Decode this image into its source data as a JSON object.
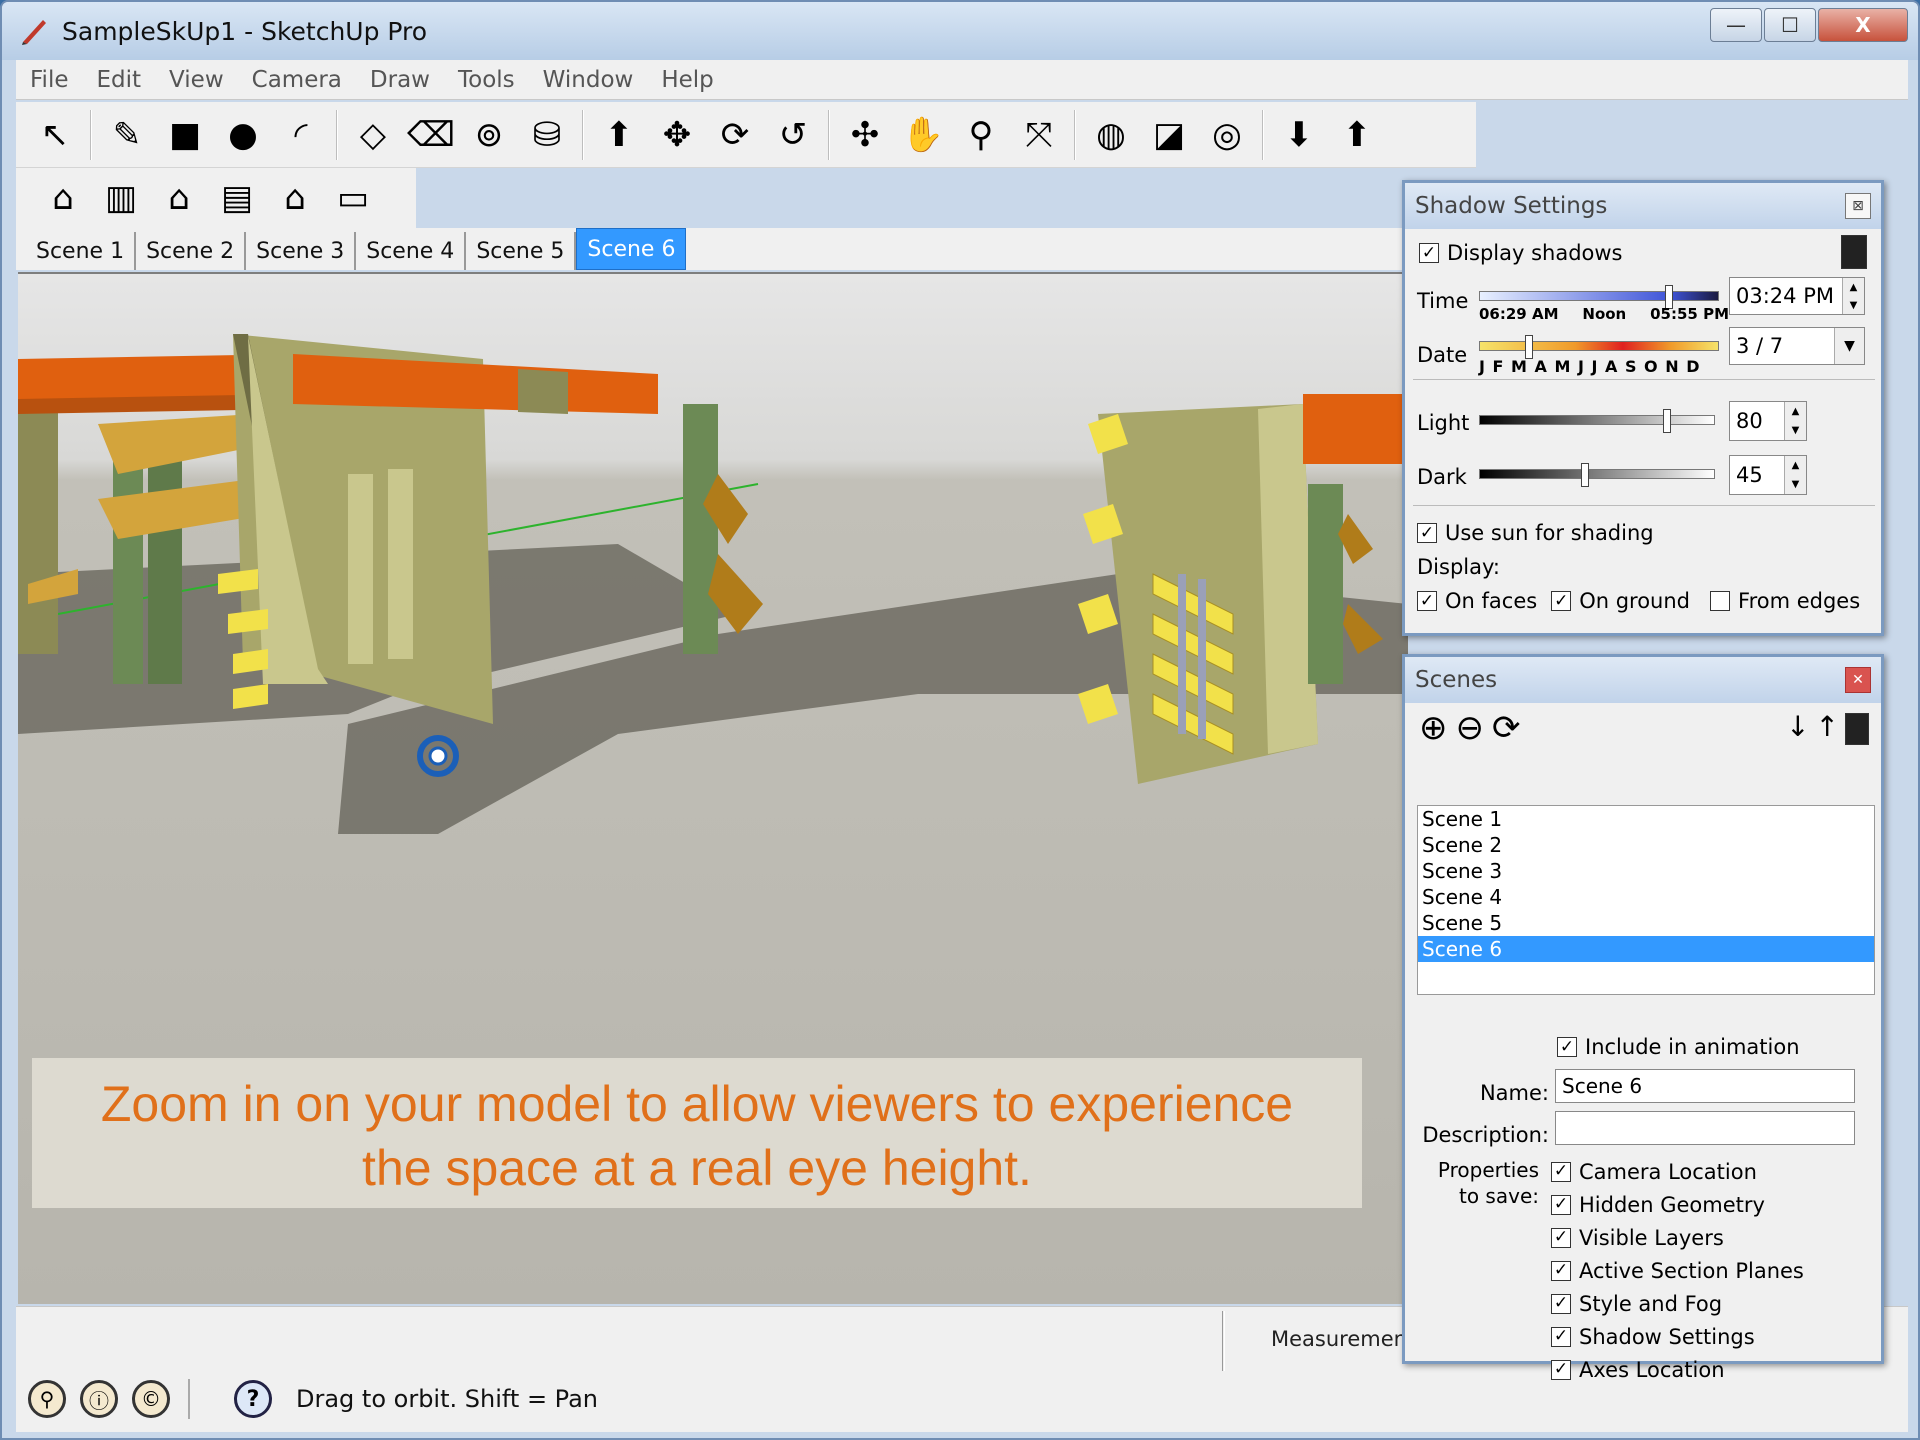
{
  "window": {
    "title": "SampleSkUp1 - SketchUp Pro",
    "minimize": "—",
    "maximize": "☐",
    "close": "X"
  },
  "menu": [
    "File",
    "Edit",
    "View",
    "Camera",
    "Draw",
    "Tools",
    "Window",
    "Help"
  ],
  "toolbar1": [
    {
      "name": "select-tool-icon",
      "glyph": "↖"
    },
    {
      "name": "pencil-tool-icon",
      "glyph": "✎"
    },
    {
      "name": "rectangle-tool-icon",
      "glyph": "■"
    },
    {
      "name": "circle-tool-icon",
      "glyph": "●"
    },
    {
      "name": "arc-tool-icon",
      "glyph": "◜"
    },
    {
      "name": "make-component-icon",
      "glyph": "◇"
    },
    {
      "name": "eraser-tool-icon",
      "glyph": "⌫"
    },
    {
      "name": "tape-measure-icon",
      "glyph": "⊚"
    },
    {
      "name": "paint-bucket-icon",
      "glyph": "⛁"
    },
    {
      "name": "push-pull-icon",
      "glyph": "⬆"
    },
    {
      "name": "move-tool-icon",
      "glyph": "✥"
    },
    {
      "name": "rotate-tool-icon",
      "glyph": "⟳"
    },
    {
      "name": "offset-tool-icon",
      "glyph": "↺"
    },
    {
      "name": "orbit-tool-icon",
      "glyph": "✣"
    },
    {
      "name": "pan-tool-icon",
      "glyph": "✋"
    },
    {
      "name": "zoom-tool-icon",
      "glyph": "⚲"
    },
    {
      "name": "zoom-extents-icon",
      "glyph": "⤧"
    },
    {
      "name": "get-models-icon",
      "glyph": "◍"
    },
    {
      "name": "share-model-icon",
      "glyph": "◪"
    },
    {
      "name": "earth-icon",
      "glyph": "◎"
    },
    {
      "name": "get-components-icon",
      "glyph": "⬇"
    },
    {
      "name": "share-component-icon",
      "glyph": "⬆"
    }
  ],
  "toolbar2": [
    {
      "name": "iso-view-icon",
      "glyph": "⌂"
    },
    {
      "name": "top-view-icon",
      "glyph": "▥"
    },
    {
      "name": "front-view-icon",
      "glyph": "⌂"
    },
    {
      "name": "right-view-icon",
      "glyph": "▤"
    },
    {
      "name": "back-view-icon",
      "glyph": "⌂"
    },
    {
      "name": "left-view-icon",
      "glyph": "▭"
    }
  ],
  "scene_tabs": [
    "Scene 1",
    "Scene 2",
    "Scene 3",
    "Scene 4",
    "Scene 5",
    "Scene 6"
  ],
  "active_scene_tab": "Scene 6",
  "caption": {
    "line1": "Zoom in on your model to allow viewers to experience",
    "line2": "the space at a real eye height."
  },
  "status": {
    "measurements_label": "Measurements",
    "message": "Drag to orbit.  Shift = Pan",
    "icons": [
      "geo-location-icon",
      "credits-icon",
      "license-icon"
    ]
  },
  "shadow_settings": {
    "title": "Shadow Settings",
    "display_shadows": "Display shadows",
    "time_label": "Time",
    "time_ticks": [
      "06:29 AM",
      "Noon",
      "05:55 PM"
    ],
    "time_value": "03:24 PM",
    "time_fraction": 0.82,
    "date_label": "Date",
    "months": "J F M A M J J A S O N D",
    "date_value": "3 / 7",
    "date_fraction": 0.2,
    "light_label": "Light",
    "light_value": "80",
    "dark_label": "Dark",
    "dark_value": "45",
    "use_sun": "Use sun for shading",
    "display_label": "Display:",
    "on_faces": "On faces",
    "on_ground": "On ground",
    "from_edges": "From edges"
  },
  "scenes_panel": {
    "title": "Scenes",
    "list": [
      "Scene 1",
      "Scene 2",
      "Scene 3",
      "Scene 4",
      "Scene 5",
      "Scene 6"
    ],
    "selected": "Scene 6",
    "include_animation": "Include in animation",
    "name_label": "Name:",
    "name_value": "Scene 6",
    "description_label": "Description:",
    "description_value": "",
    "properties_label_1": "Properties",
    "properties_label_2": "to save:",
    "properties": [
      "Camera Location",
      "Hidden Geometry",
      "Visible Layers",
      "Active Section Planes",
      "Style and Fog",
      "Shadow Settings",
      "Axes Location"
    ]
  },
  "colors": {
    "accent": "#3399ff",
    "caption": "#e0701a",
    "beam": "#e0600f",
    "wall": "#a8a66a",
    "post": "#6c8a55",
    "plank": "#d3a43c",
    "slat": "#f2e14a"
  }
}
